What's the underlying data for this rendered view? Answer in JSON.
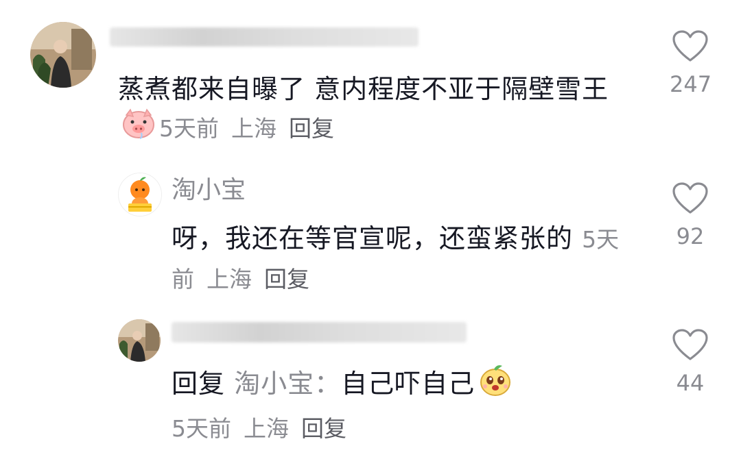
{
  "comments": [
    {
      "username": "",
      "text": "蒸煮都来自曝了 意内程度不亚于隔壁雪王",
      "emoji": "pig-face",
      "time": "5天前",
      "location": "上海",
      "reply_label": "回复",
      "likes": "247"
    },
    {
      "username": "淘小宝",
      "text": "呀，我还在等官宣呢，还蛮紧张的",
      "time": "5天前",
      "location": "上海",
      "reply_label": "回复",
      "likes": "92"
    },
    {
      "username": "",
      "reply_prefix": "回复",
      "reply_target": "淘小宝：",
      "text": "自己吓自己",
      "emoji": "mango-face",
      "time": "5天前",
      "location": "上海",
      "reply_label": "回复",
      "likes": "44"
    }
  ],
  "colors": {
    "primary_text": "#161823",
    "secondary_text": "#8a8b91",
    "icon_stroke": "#8a8b91"
  }
}
